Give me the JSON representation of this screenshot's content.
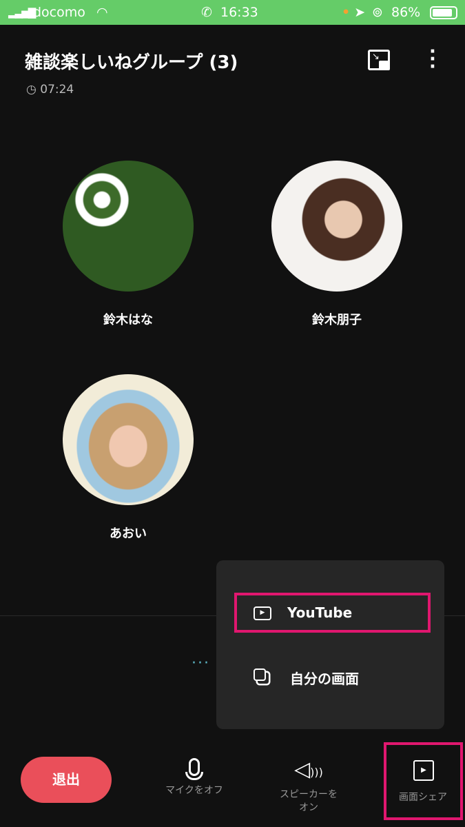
{
  "status_bar": {
    "carrier": "docomo",
    "time": "16:33",
    "battery": "86%",
    "bg_color": "#65cc68"
  },
  "header": {
    "title": "雑談楽しいねグループ (3)",
    "duration": "07:24"
  },
  "participants": [
    {
      "name": "鈴木はな"
    },
    {
      "name": "鈴木朋子"
    },
    {
      "name": "あおい"
    }
  ],
  "share_menu": {
    "items": [
      {
        "label": "YouTube",
        "icon": "play-box-icon",
        "highlighted": true
      },
      {
        "label": "自分の画面",
        "icon": "screen-copy-icon"
      }
    ]
  },
  "toolbar": {
    "leave": "退出",
    "mic": "マイクをオフ",
    "speaker": "スピーカーを\nオン",
    "share": "画面シェア"
  },
  "colors": {
    "accent": "#e0176f",
    "leave": "#ea4f5a",
    "dots": "#5fb8c8"
  }
}
